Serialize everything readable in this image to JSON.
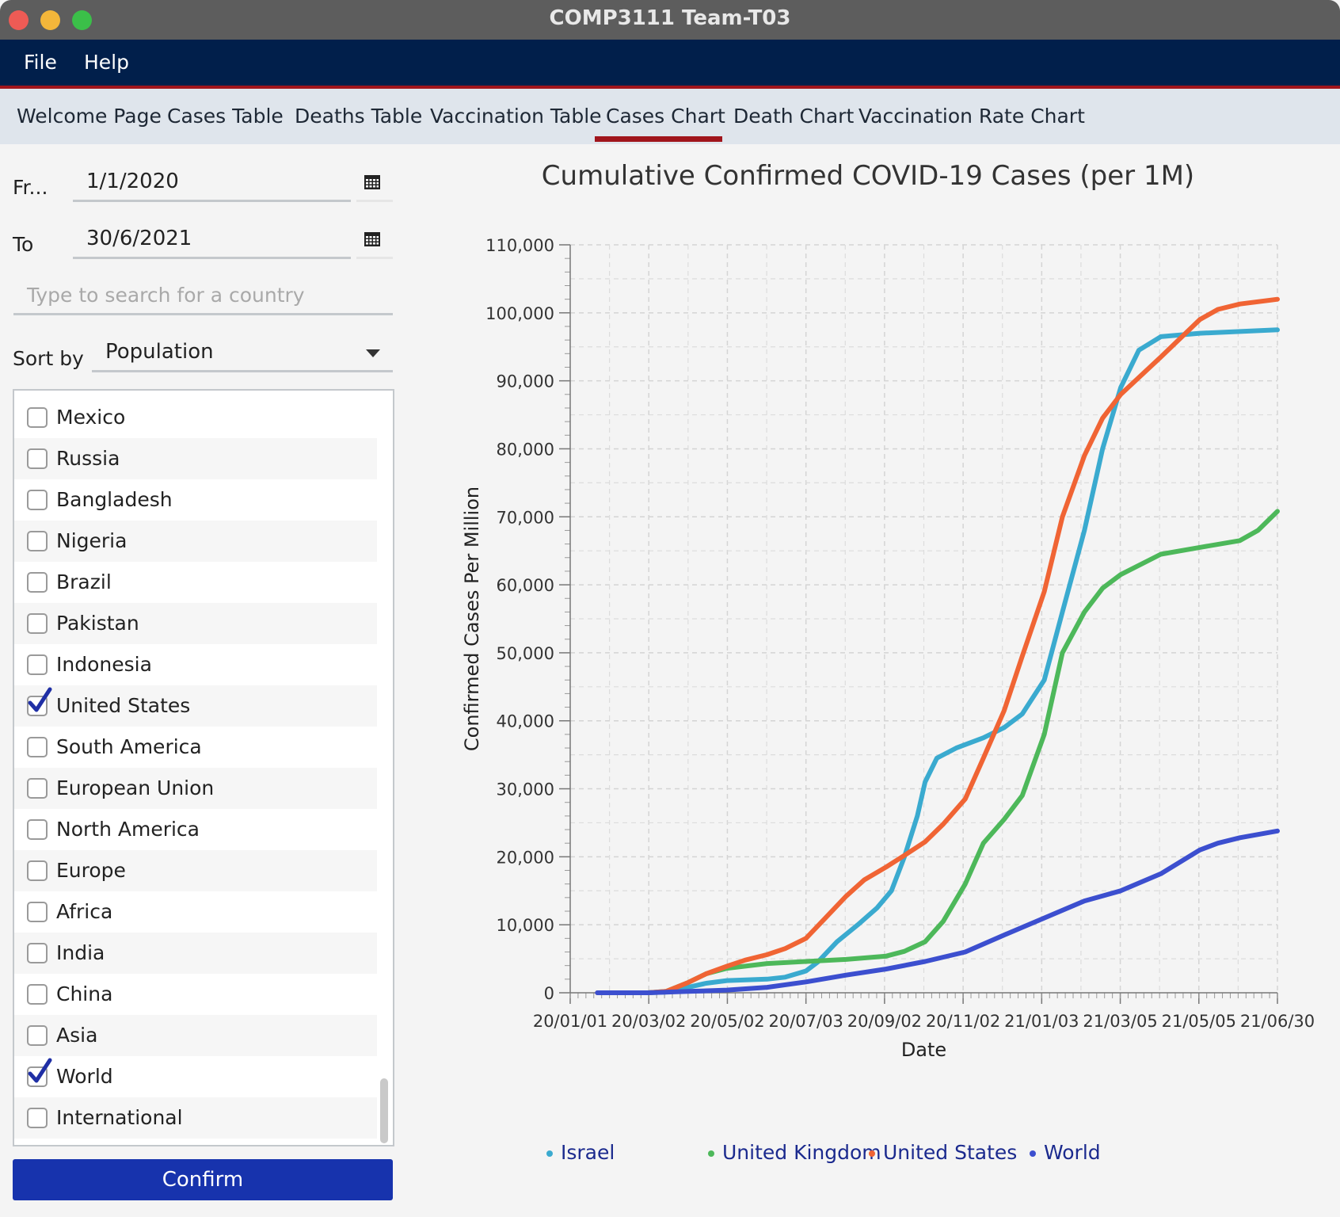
{
  "window": {
    "title": "COMP3111 Team-T03"
  },
  "menu": {
    "file": "File",
    "help": "Help"
  },
  "tabs": [
    "Welcome Page",
    "Cases Table",
    "Deaths Table",
    "Vaccination Table",
    "Cases Chart",
    "Death Chart",
    "Vaccination Rate Chart"
  ],
  "active_tab": "Cases Chart",
  "controls": {
    "from_label": "Fr...",
    "from_value": "1/1/2020",
    "to_label": "To",
    "to_value": "30/6/2021",
    "search_placeholder": "Type to search for a country",
    "sort_label": "Sort by",
    "sort_value": "Population",
    "confirm_label": "Confirm"
  },
  "countries": [
    {
      "name": "Mexico",
      "checked": false
    },
    {
      "name": "Russia",
      "checked": false
    },
    {
      "name": "Bangladesh",
      "checked": false
    },
    {
      "name": "Nigeria",
      "checked": false
    },
    {
      "name": "Brazil",
      "checked": false
    },
    {
      "name": "Pakistan",
      "checked": false
    },
    {
      "name": "Indonesia",
      "checked": false
    },
    {
      "name": "United States",
      "checked": true
    },
    {
      "name": "South America",
      "checked": false
    },
    {
      "name": "European Union",
      "checked": false
    },
    {
      "name": "North America",
      "checked": false
    },
    {
      "name": "Europe",
      "checked": false
    },
    {
      "name": "Africa",
      "checked": false
    },
    {
      "name": "India",
      "checked": false
    },
    {
      "name": "China",
      "checked": false
    },
    {
      "name": "Asia",
      "checked": false
    },
    {
      "name": "World",
      "checked": true
    },
    {
      "name": "International",
      "checked": false
    }
  ],
  "icons": {
    "calendar": "calendar-icon",
    "dropdown": "chevron-down-icon",
    "check": "checkmark-icon"
  },
  "chart_data": {
    "type": "line",
    "title": "Cumulative Confirmed COVID-19 Cases (per 1M)",
    "xlabel": "Date",
    "ylabel": "Confirmed Cases Per Million",
    "x_tick_labels": [
      "20/01/01",
      "20/03/02",
      "20/05/02",
      "20/07/03",
      "20/09/02",
      "20/11/02",
      "21/01/03",
      "21/03/05",
      "21/05/05",
      "21/06/30"
    ],
    "y_tick_labels": [
      "0",
      "10,000",
      "20,000",
      "30,000",
      "40,000",
      "50,000",
      "60,000",
      "70,000",
      "80,000",
      "90,000",
      "100,000",
      "110,000"
    ],
    "xlim": [
      "2020-01-01",
      "2021-06-30"
    ],
    "ylim": [
      0,
      110000
    ],
    "grid": true,
    "legend_position": "bottom",
    "series": [
      {
        "name": "Israel",
        "color": "#3aaacf",
        "points": [
          [
            "2020-01-22",
            0
          ],
          [
            "2020-03-01",
            0
          ],
          [
            "2020-03-15",
            100
          ],
          [
            "2020-04-01",
            800
          ],
          [
            "2020-04-15",
            1400
          ],
          [
            "2020-05-01",
            1800
          ],
          [
            "2020-06-01",
            2000
          ],
          [
            "2020-06-15",
            2300
          ],
          [
            "2020-07-01",
            3200
          ],
          [
            "2020-07-10",
            4500
          ],
          [
            "2020-07-25",
            7500
          ],
          [
            "2020-08-10",
            10000
          ],
          [
            "2020-08-25",
            12500
          ],
          [
            "2020-09-05",
            15000
          ],
          [
            "2020-09-15",
            20000
          ],
          [
            "2020-09-25",
            26000
          ],
          [
            "2020-10-01",
            31000
          ],
          [
            "2020-10-10",
            34500
          ],
          [
            "2020-10-25",
            36000
          ],
          [
            "2020-11-15",
            37500
          ],
          [
            "2020-12-01",
            39000
          ],
          [
            "2020-12-15",
            41000
          ],
          [
            "2021-01-01",
            46000
          ],
          [
            "2021-01-15",
            56000
          ],
          [
            "2021-02-01",
            68000
          ],
          [
            "2021-02-15",
            80000
          ],
          [
            "2021-03-01",
            89000
          ],
          [
            "2021-03-15",
            94500
          ],
          [
            "2021-04-01",
            96500
          ],
          [
            "2021-05-01",
            97000
          ],
          [
            "2021-06-30",
            97500
          ]
        ]
      },
      {
        "name": "United Kingdom",
        "color": "#4db85a",
        "points": [
          [
            "2020-01-31",
            0
          ],
          [
            "2020-03-01",
            0
          ],
          [
            "2020-03-15",
            200
          ],
          [
            "2020-04-01",
            1500
          ],
          [
            "2020-04-15",
            2800
          ],
          [
            "2020-05-01",
            3600
          ],
          [
            "2020-06-01",
            4300
          ],
          [
            "2020-07-01",
            4600
          ],
          [
            "2020-08-01",
            4900
          ],
          [
            "2020-09-01",
            5400
          ],
          [
            "2020-09-15",
            6100
          ],
          [
            "2020-10-01",
            7500
          ],
          [
            "2020-10-15",
            10500
          ],
          [
            "2020-11-01",
            16000
          ],
          [
            "2020-11-15",
            22000
          ],
          [
            "2020-12-01",
            25500
          ],
          [
            "2020-12-15",
            29000
          ],
          [
            "2021-01-01",
            38000
          ],
          [
            "2021-01-15",
            50000
          ],
          [
            "2021-02-01",
            56000
          ],
          [
            "2021-02-15",
            59500
          ],
          [
            "2021-03-01",
            61500
          ],
          [
            "2021-04-01",
            64500
          ],
          [
            "2021-05-01",
            65500
          ],
          [
            "2021-06-01",
            66500
          ],
          [
            "2021-06-15",
            68000
          ],
          [
            "2021-06-30",
            70800
          ]
        ]
      },
      {
        "name": "United States",
        "color": "#f06434",
        "points": [
          [
            "2020-01-22",
            0
          ],
          [
            "2020-03-01",
            0
          ],
          [
            "2020-03-15",
            200
          ],
          [
            "2020-04-01",
            1500
          ],
          [
            "2020-04-15",
            2800
          ],
          [
            "2020-05-01",
            3900
          ],
          [
            "2020-05-15",
            4800
          ],
          [
            "2020-06-01",
            5600
          ],
          [
            "2020-06-15",
            6500
          ],
          [
            "2020-07-01",
            8000
          ],
          [
            "2020-07-15",
            10800
          ],
          [
            "2020-08-01",
            14200
          ],
          [
            "2020-08-15",
            16600
          ],
          [
            "2020-09-01",
            18500
          ],
          [
            "2020-09-15",
            20200
          ],
          [
            "2020-10-01",
            22200
          ],
          [
            "2020-10-15",
            24800
          ],
          [
            "2020-11-01",
            28500
          ],
          [
            "2020-11-15",
            34500
          ],
          [
            "2020-12-01",
            41500
          ],
          [
            "2020-12-15",
            49500
          ],
          [
            "2021-01-01",
            59000
          ],
          [
            "2021-01-15",
            70000
          ],
          [
            "2021-02-01",
            79000
          ],
          [
            "2021-02-15",
            84500
          ],
          [
            "2021-03-01",
            88000
          ],
          [
            "2021-04-01",
            93500
          ],
          [
            "2021-05-01",
            99000
          ],
          [
            "2021-05-15",
            100500
          ],
          [
            "2021-06-01",
            101300
          ],
          [
            "2021-06-30",
            102000
          ]
        ]
      },
      {
        "name": "World",
        "color": "#3c4fcf",
        "points": [
          [
            "2020-01-22",
            0
          ],
          [
            "2020-03-01",
            0
          ],
          [
            "2020-04-01",
            200
          ],
          [
            "2020-05-01",
            400
          ],
          [
            "2020-06-01",
            800
          ],
          [
            "2020-07-01",
            1600
          ],
          [
            "2020-08-01",
            2600
          ],
          [
            "2020-09-01",
            3500
          ],
          [
            "2020-10-01",
            4600
          ],
          [
            "2020-11-01",
            6000
          ],
          [
            "2020-12-01",
            8500
          ],
          [
            "2021-01-01",
            11000
          ],
          [
            "2021-02-01",
            13500
          ],
          [
            "2021-03-01",
            15000
          ],
          [
            "2021-04-01",
            17500
          ],
          [
            "2021-05-01",
            21000
          ],
          [
            "2021-05-15",
            22000
          ],
          [
            "2021-06-01",
            22800
          ],
          [
            "2021-06-30",
            23800
          ]
        ]
      }
    ]
  }
}
